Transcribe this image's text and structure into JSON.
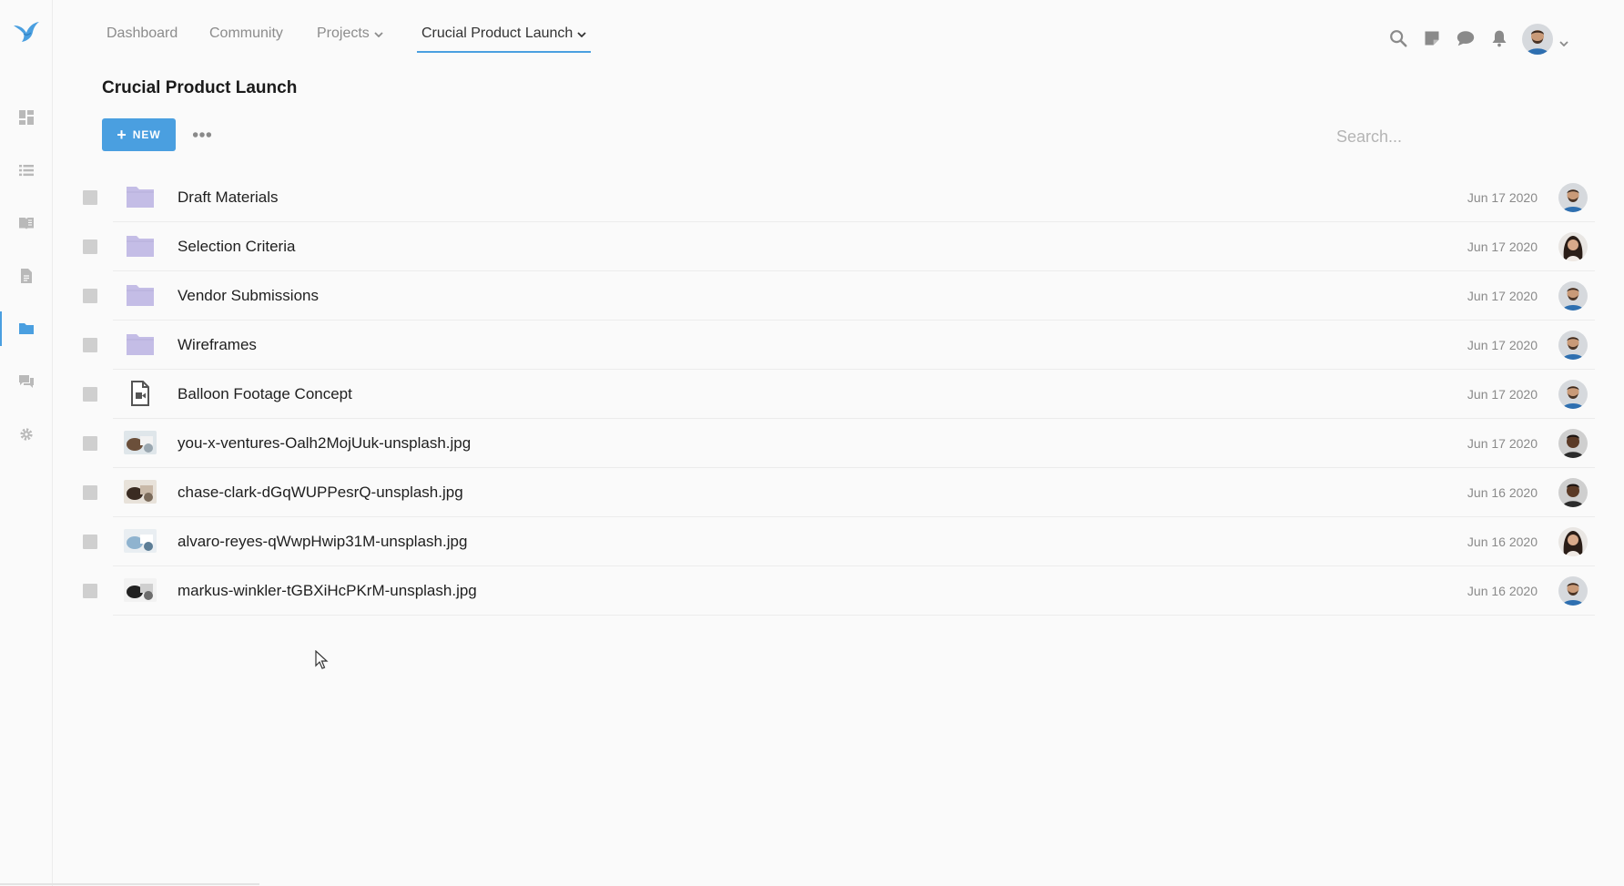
{
  "nav": {
    "tabs": [
      {
        "label": "Dashboard"
      },
      {
        "label": "Community"
      },
      {
        "label": "Projects"
      },
      {
        "label": "Crucial Product Launch"
      }
    ]
  },
  "rail": {
    "items": [
      "dashboard-icon",
      "list-icon",
      "book-icon",
      "document-icon",
      "folder-icon",
      "chat-icon",
      "gear-icon"
    ],
    "active_index": 4
  },
  "header_icons": [
    "search-icon",
    "notes-icon",
    "chat-bubble-icon",
    "bell-icon"
  ],
  "page": {
    "title": "Crucial Product Launch",
    "new_label": "NEW",
    "search_placeholder": "Search..."
  },
  "colors": {
    "accent": "#4a9fe0",
    "folder": "#c4bde6",
    "checkbox": "#cfcfcf"
  },
  "files": [
    {
      "name": "Draft Materials",
      "date": "Jun 17 2020",
      "kind": "folder",
      "owner": "man-a"
    },
    {
      "name": "Selection Criteria",
      "date": "Jun 17 2020",
      "kind": "folder",
      "owner": "woman"
    },
    {
      "name": "Vendor Submissions",
      "date": "Jun 17 2020",
      "kind": "folder",
      "owner": "man-a"
    },
    {
      "name": "Wireframes",
      "date": "Jun 17 2020",
      "kind": "folder",
      "owner": "man-a"
    },
    {
      "name": "Balloon Footage Concept",
      "date": "Jun 17 2020",
      "kind": "video-doc",
      "owner": "man-a"
    },
    {
      "name": "you-x-ventures-Oalh2MojUuk-unsplash.jpg",
      "date": "Jun 17 2020",
      "kind": "image",
      "owner": "man-b"
    },
    {
      "name": "chase-clark-dGqWUPPesrQ-unsplash.jpg",
      "date": "Jun 16 2020",
      "kind": "image",
      "owner": "man-b"
    },
    {
      "name": "alvaro-reyes-qWwpHwip31M-unsplash.jpg",
      "date": "Jun 16 2020",
      "kind": "image",
      "owner": "woman"
    },
    {
      "name": "markus-winkler-tGBXiHcPKrM-unsplash.jpg",
      "date": "Jun 16 2020",
      "kind": "image",
      "owner": "man-a"
    }
  ]
}
